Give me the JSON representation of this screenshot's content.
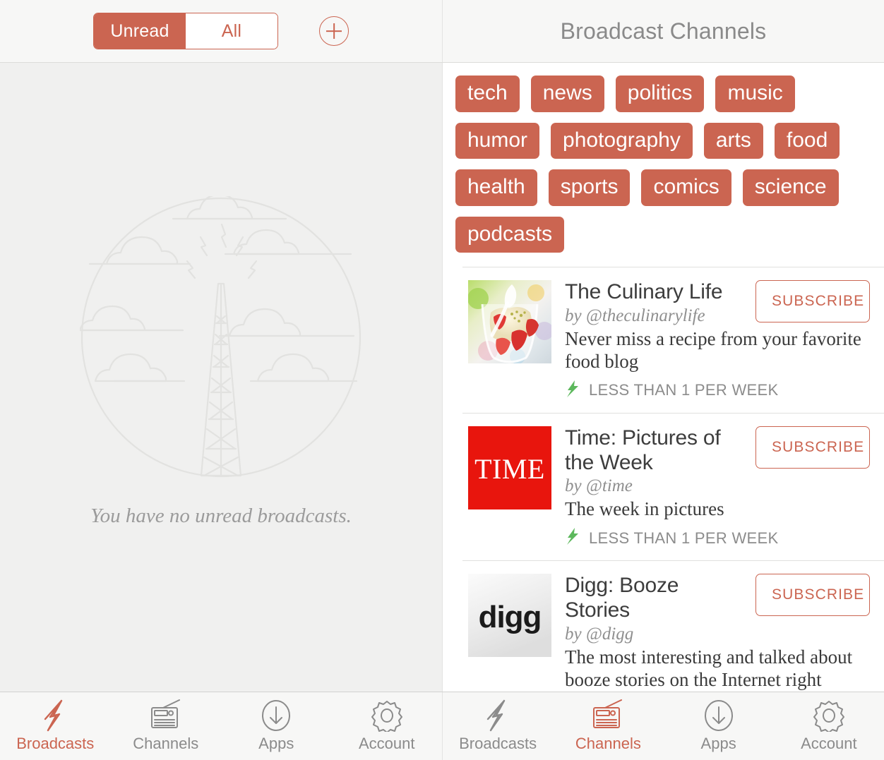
{
  "theme": {
    "accent": "#cb6551",
    "muted_text": "#8b8b8b",
    "green": "#5cb85c",
    "left_bg": "#f0f0ef",
    "right_bg": "#ffffff"
  },
  "left_pane": {
    "segmented": {
      "options": [
        "Unread",
        "All"
      ],
      "selected": "Unread"
    },
    "add_button_icon": "plus-circle-icon",
    "empty_state": {
      "illustration": "broadcast-tower-illustration",
      "message": "You have no unread broadcasts."
    }
  },
  "right_pane": {
    "title": "Broadcast Channels",
    "tags": [
      "tech",
      "news",
      "politics",
      "music",
      "humor",
      "photography",
      "arts",
      "food",
      "health",
      "sports",
      "comics",
      "science",
      "podcasts"
    ],
    "subscribe_label": "SUBSCRIBE",
    "channels": [
      {
        "title": "The Culinary Life",
        "by": "by @theculinarylife",
        "description": "Never miss a recipe from your favorite food blog",
        "frequency": "LESS THAN 1 PER WEEK",
        "frequency_icon": "green-lightning-icon",
        "thumb": "culinary-dessert-photo",
        "subscribe": "SUBSCRIBE"
      },
      {
        "title": "Time: Pictures of the Week",
        "by": "by @time",
        "description": "The week in pictures",
        "frequency": "LESS THAN 1 PER WEEK",
        "frequency_icon": "green-lightning-icon",
        "thumb": "time-logo",
        "thumb_text": "TIME",
        "subscribe": "SUBSCRIBE"
      },
      {
        "title": "Digg: Booze Stories",
        "by": "by @digg",
        "description": "The most interesting and talked about booze stories on the Internet right",
        "frequency": "",
        "frequency_icon": "",
        "thumb": "digg-logo",
        "thumb_text": "digg",
        "subscribe": "SUBSCRIBE"
      }
    ]
  },
  "tabbar_left": {
    "active": "Broadcasts",
    "items": [
      {
        "label": "Broadcasts",
        "icon": "lightning-bolt-icon"
      },
      {
        "label": "Channels",
        "icon": "radio-icon"
      },
      {
        "label": "Apps",
        "icon": "download-circle-icon"
      },
      {
        "label": "Account",
        "icon": "gear-icon"
      }
    ]
  },
  "tabbar_right": {
    "active": "Channels",
    "items": [
      {
        "label": "Broadcasts",
        "icon": "lightning-bolt-icon"
      },
      {
        "label": "Channels",
        "icon": "radio-icon"
      },
      {
        "label": "Apps",
        "icon": "download-circle-icon"
      },
      {
        "label": "Account",
        "icon": "gear-icon"
      }
    ]
  }
}
